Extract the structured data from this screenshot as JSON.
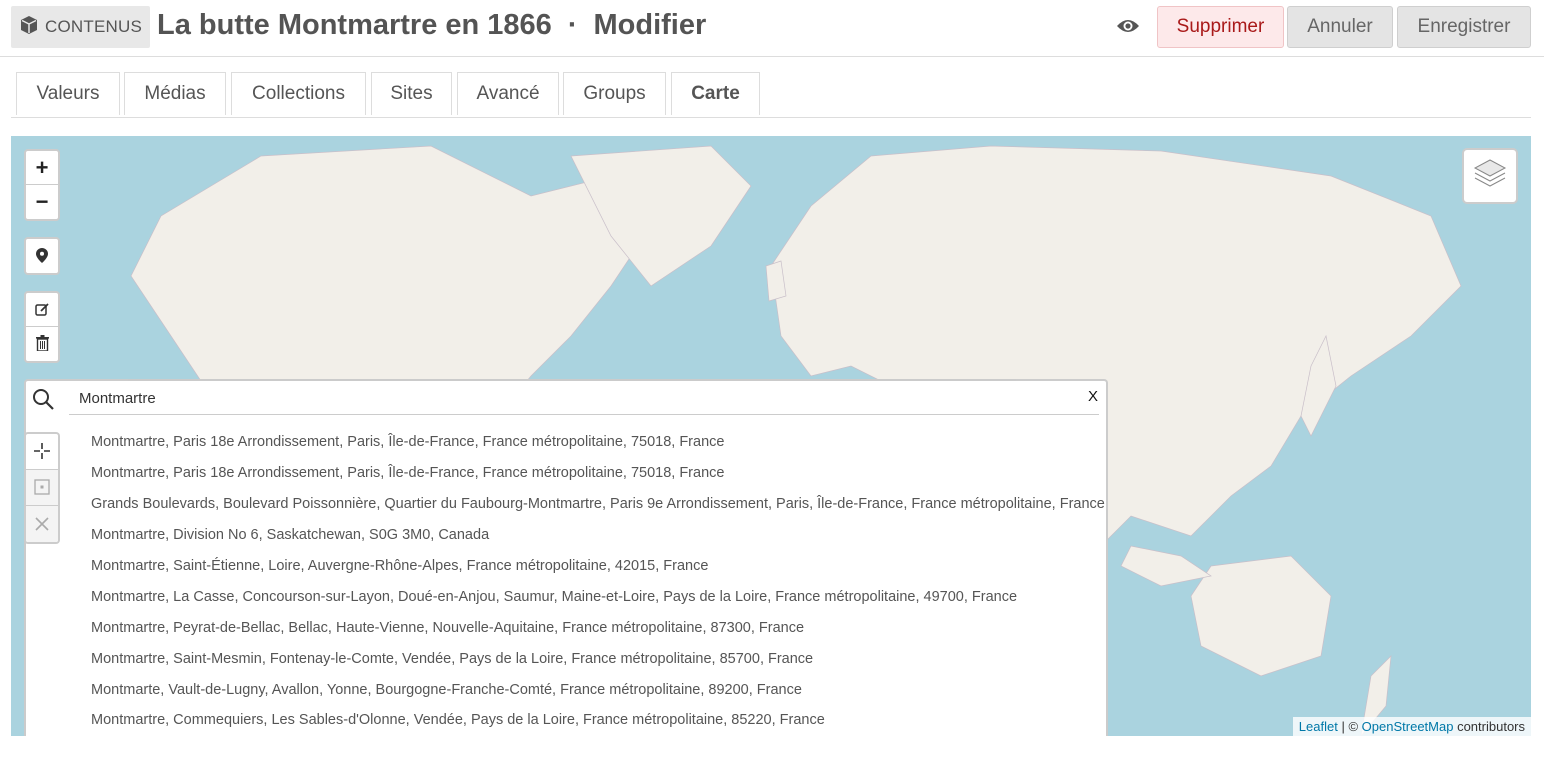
{
  "header": {
    "section_label": "CONTENUS",
    "title": "La butte Montmartre en 1866",
    "separator": "·",
    "mode": "Modifier",
    "buttons": {
      "delete": "Supprimer",
      "cancel": "Annuler",
      "save": "Enregistrer"
    }
  },
  "tabs": [
    {
      "label": "Valeurs"
    },
    {
      "label": "Médias"
    },
    {
      "label": "Collections"
    },
    {
      "label": "Sites"
    },
    {
      "label": "Avancé"
    },
    {
      "label": "Groups"
    },
    {
      "label": "Carte",
      "active": true
    }
  ],
  "map": {
    "controls": {
      "zoom_in": "+",
      "zoom_out": "−",
      "clear_search": "X"
    },
    "search": {
      "value": "Montmartre",
      "results": [
        "Montmartre, Paris 18e Arrondissement, Paris, Île-de-France, France métropolitaine, 75018, France",
        "Montmartre, Paris 18e Arrondissement, Paris, Île-de-France, France métropolitaine, 75018, France",
        "Grands Boulevards, Boulevard Poissonnière, Quartier du Faubourg-Montmartre, Paris 9e Arrondissement, Paris, Île-de-France, France métropolitaine, France",
        "Montmartre, Division No 6, Saskatchewan, S0G 3M0, Canada",
        "Montmartre, Saint-Étienne, Loire, Auvergne-Rhône-Alpes, France métropolitaine, 42015, France",
        "Montmartre, La Casse, Concourson-sur-Layon, Doué-en-Anjou, Saumur, Maine-et-Loire, Pays de la Loire, France métropolitaine, 49700, France",
        "Montmartre, Peyrat-de-Bellac, Bellac, Haute-Vienne, Nouvelle-Aquitaine, France métropolitaine, 87300, France",
        "Montmartre, Saint-Mesmin, Fontenay-le-Comte, Vendée, Pays de la Loire, France métropolitaine, 85700, France",
        "Montmarte, Vault-de-Lugny, Avallon, Yonne, Bourgogne-Franche-Comté, France métropolitaine, 89200, France",
        "Montmartre, Commequiers, Les Sables-d'Olonne, Vendée, Pays de la Loire, France métropolitaine, 85220, France"
      ]
    },
    "attribution": {
      "leaflet": "Leaflet",
      "sep": "| ©",
      "osm": "OpenStreetMap",
      "suffix": "contributors"
    },
    "colors": {
      "water": "#aad3df",
      "land": "#f2efe9",
      "border": "#c9a9c9"
    }
  }
}
